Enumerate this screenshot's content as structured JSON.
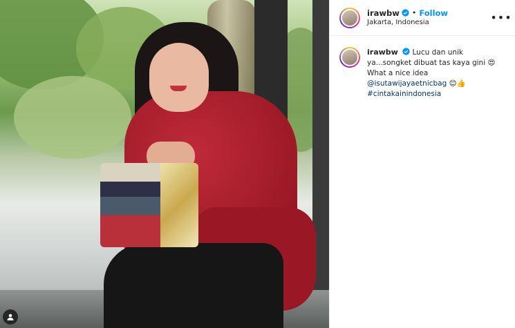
{
  "post": {
    "username": "irawbw",
    "follow_label": "Follow",
    "separator": "•",
    "location": "Jakarta, Indonesia",
    "more_label": "•••",
    "caption": {
      "username": "irawbw",
      "text_1": "Lucu dan unik ya...songket dibuat tas kaya gini",
      "emoji_1": "😍",
      "text_2": "What a nice idea",
      "mention": "@isutawijayaetnicbag",
      "emoji_2": "😊👍",
      "hashtag": "#cintakainindonesia"
    }
  },
  "icons": {
    "verified": "verified-badge-icon",
    "more": "more-options-icon",
    "tag": "user-tag-icon"
  },
  "colors": {
    "accent": "#0095f6",
    "link": "#00376b",
    "text": "#262626"
  }
}
